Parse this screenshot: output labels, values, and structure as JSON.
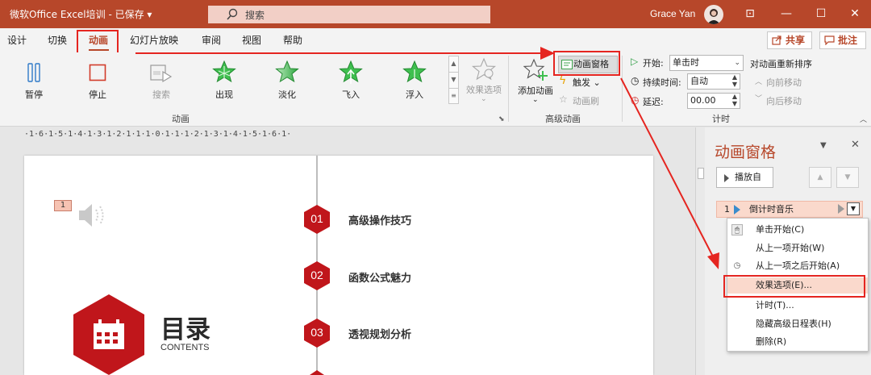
{
  "titlebar": {
    "title": "微软Office Excel培训 - 已保存 ▾",
    "search": "搜索",
    "user": "Grace Yan",
    "controls": [
      "⊡",
      "—",
      "☐",
      "✕"
    ]
  },
  "tabs": [
    "设计",
    "切换",
    "动画",
    "幻灯片放映",
    "审阅",
    "视图",
    "帮助"
  ],
  "actions": {
    "share": "共享",
    "comment": "批注"
  },
  "ribbon": {
    "animation_buttons": [
      "暂停",
      "停止",
      "搜索",
      "出现",
      "淡化",
      "飞入",
      "浮入"
    ],
    "effect_options": "效果选项",
    "group_animation": "动画",
    "add_animation": "添加动画",
    "animation_pane": "动画窗格",
    "trigger": "触发",
    "painter": "动画刷",
    "group_advanced": "高级动画",
    "start_label": "开始:",
    "start_value": "单击时",
    "duration_label": "持续时间:",
    "duration_value": "自动",
    "delay_label": "延迟:",
    "delay_value": "00.00",
    "reorder_title": "对动画重新排序",
    "move_earlier": "向前移动",
    "move_later": "向后移动",
    "group_timing": "计时"
  },
  "ruler": "·1·6·1·5·1·4·1·3·1·2·1·1·1·0·1·1·1·2·1·3·1·4·1·5·1·6·1·",
  "slide": {
    "tag": "1",
    "items": [
      {
        "num": "01",
        "label": "高级操作技巧"
      },
      {
        "num": "02",
        "label": "函数公式魅力"
      },
      {
        "num": "03",
        "label": "透视规划分析"
      }
    ],
    "title": "目录",
    "subtitle": "CONTENTS"
  },
  "pane": {
    "title": "动画窗格",
    "play": "播放自",
    "item_num": "1",
    "item_name": "倒计时音乐"
  },
  "menu": [
    "单击开始(C)",
    "从上一项开始(W)",
    "从上一项之后开始(A)",
    "效果选项(E)...",
    "计时(T)...",
    "隐藏高级日程表(H)",
    "删除(R)"
  ],
  "colors": {
    "accent": "#b7472a",
    "annotation": "#e52520",
    "slide_red": "#c0161b"
  }
}
